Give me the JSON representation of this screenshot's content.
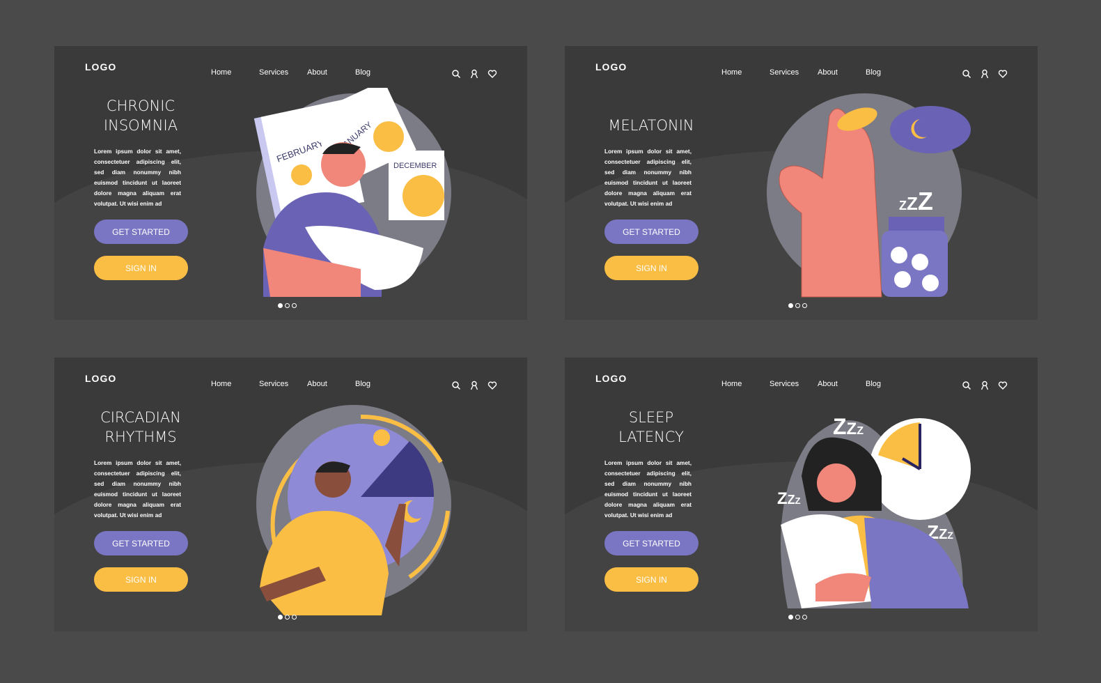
{
  "colors": {
    "page_bg": "#4a4a4a",
    "card_bg": "#3a3a3a",
    "primary": "#7a76c4",
    "accent": "#fbbe45",
    "skin": "#f0877a"
  },
  "nav": {
    "logo": "LOGO",
    "links": [
      "Home",
      "Services",
      "About",
      "Blog"
    ],
    "icons": [
      "search-icon",
      "user-icon",
      "heart-icon"
    ]
  },
  "body_text": "Lorem ipsum dolor sit amet, consectetuer adipiscing elit, sed diam nonummy nibh euismod tincidunt ut laoreet dolore magna aliquam erat volutpat. Ut wisi enim ad",
  "buttons": {
    "get_started": "GET STARTED",
    "sign_in": "SIGN IN"
  },
  "carousel": {
    "total": 3,
    "active": 1
  },
  "cards": [
    {
      "title_line1": "CHRONIC",
      "title_line2": "INSOMNIA",
      "illustration": "man-with-calendars",
      "labels": [
        "FEBRUARY",
        "JANUARY",
        "DECEMBER"
      ]
    },
    {
      "title_line1": "MELATONIN",
      "title_line2": "",
      "illustration": "hand-with-pill",
      "labels": [
        "Z",
        "Z",
        "Z"
      ]
    },
    {
      "title_line1": "CIRCADIAN",
      "title_line2": "RHYTHMS",
      "illustration": "man-day-night-cycle",
      "labels": []
    },
    {
      "title_line1": "SLEEP",
      "title_line2": "LATENCY",
      "illustration": "woman-with-clock",
      "labels": [
        "Z",
        "Z",
        "Z"
      ]
    }
  ]
}
